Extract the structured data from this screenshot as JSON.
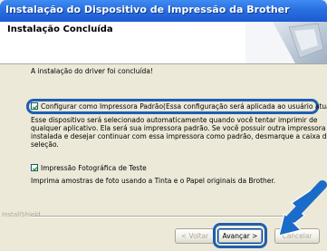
{
  "window": {
    "title": "Instalação do Dispositivo de Impressão da Brother"
  },
  "header": {
    "title": "Instalação Concluída"
  },
  "content": {
    "status_text": "A instalação do driver foi concluída!",
    "default_printer": {
      "checked": true,
      "label": "Configurar como Impressora Padrão(Essa configuração será aplicada ao usuário atual.)",
      "description_lines": [
        "Esse dispositivo será selecionado automaticamente quando você tentar imprimir de",
        "qualquer aplicativo. Ela será sua impressora padrão. Se você possuir outra impressora",
        "instalada e desejar continuar com essa impressora como padrão, desmarque a caixa de",
        "seleção."
      ]
    },
    "test_print": {
      "checked": true,
      "label": "Impressão Fotográfica de Teste",
      "description": "Imprima amostras de foto usando a Tinta e o Papel originais da Brother."
    }
  },
  "footer": {
    "brand": "InstallShield",
    "back_label": "< Voltar",
    "next_label": "Avançar >",
    "cancel_label": "Cancelar"
  },
  "colors": {
    "titlebar": "#2a6fe0",
    "highlight": "#1f5fb3",
    "dialog_bg": "#ece9d8"
  }
}
